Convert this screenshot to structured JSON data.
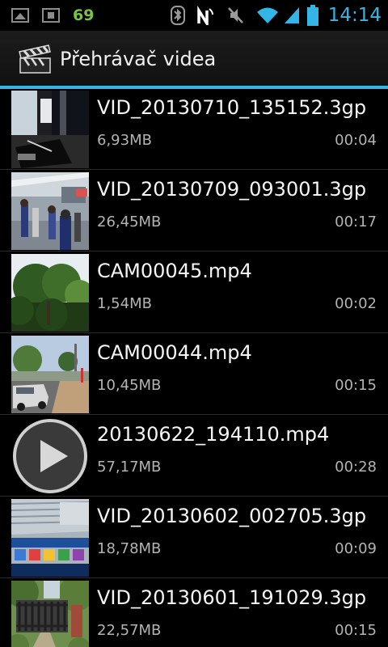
{
  "status_bar": {
    "left_icons": [
      "image-icon",
      "screenshot-icon"
    ],
    "battery_level_text": "69",
    "right_icons": [
      "bluetooth-icon",
      "nfc-icon",
      "mute-icon",
      "wifi-icon",
      "signal-icon",
      "battery-icon"
    ],
    "time": "14:14",
    "colors": {
      "battery_text": "#7bc144",
      "time": "#33b5e5"
    }
  },
  "action_bar": {
    "icon": "clapperboard-icon",
    "title": "Přehrávač videa",
    "accent": "#33b5e5"
  },
  "videos": [
    {
      "name": "VID_20130710_135152.3gp",
      "size": "6,93MB",
      "duration": "00:04",
      "thumb": "desk-scene"
    },
    {
      "name": "VID_20130709_093001.3gp",
      "size": "26,45MB",
      "duration": "00:17",
      "thumb": "mall-scene"
    },
    {
      "name": "CAM00045.mp4",
      "size": "1,54MB",
      "duration": "00:02",
      "thumb": "trees-scene"
    },
    {
      "name": "CAM00044.mp4",
      "size": "10,45MB",
      "duration": "00:15",
      "thumb": "street-scene"
    },
    {
      "name": "20130622_194110.mp4",
      "size": "57,17MB",
      "duration": "00:28",
      "thumb": "play-icon"
    },
    {
      "name": "VID_20130602_002705.3gp",
      "size": "18,78MB",
      "duration": "00:09",
      "thumb": "screen-scene"
    },
    {
      "name": "VID_20130601_191029.3gp",
      "size": "22,57MB",
      "duration": "00:15",
      "thumb": "gate-scene"
    }
  ]
}
